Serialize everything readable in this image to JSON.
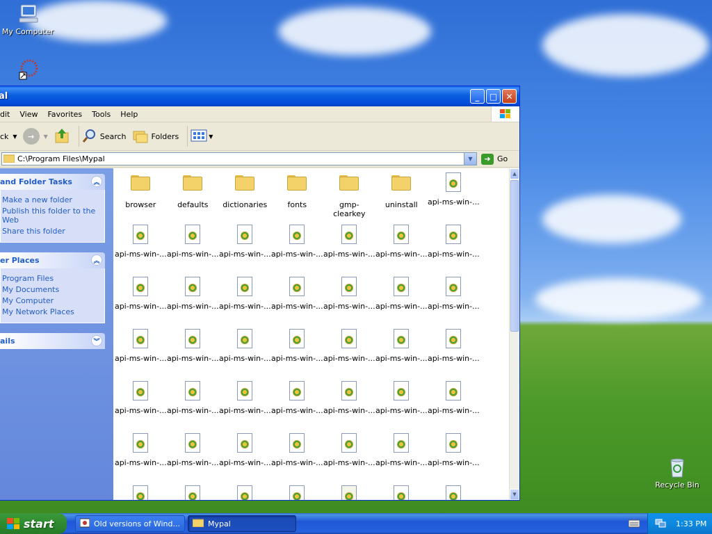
{
  "desktop": {
    "icons": [
      {
        "name": "my-computer",
        "label": "My Computer"
      },
      {
        "name": "recycle-bin",
        "label": "Recycle Bin"
      }
    ]
  },
  "window": {
    "title": "al",
    "menu": [
      "dit",
      "View",
      "Favorites",
      "Tools",
      "Help"
    ],
    "toolbar": {
      "back": "ck",
      "search": "Search",
      "folders": "Folders"
    },
    "address": {
      "path": "C:\\Program Files\\Mypal",
      "go": "Go"
    },
    "tasks": {
      "file_folder": {
        "title": "and Folder Tasks",
        "items": [
          "Make a new folder",
          "Publish this folder to the Web",
          "Share this folder"
        ]
      },
      "other_places": {
        "title": "er Places",
        "items": [
          "Program Files",
          "My Documents",
          "My Computer",
          "My Network Places"
        ]
      },
      "details": {
        "title": "ails"
      }
    },
    "items": [
      {
        "type": "folder",
        "label": "browser"
      },
      {
        "type": "folder",
        "label": "defaults"
      },
      {
        "type": "folder",
        "label": "dictionaries"
      },
      {
        "type": "folder",
        "label": "fonts"
      },
      {
        "type": "folder",
        "label": "gmp-clearkey"
      },
      {
        "type": "folder",
        "label": "uninstall"
      },
      {
        "type": "dll",
        "label": "api-ms-win-..."
      },
      {
        "type": "dll",
        "label": "api-ms-win-..."
      },
      {
        "type": "dll",
        "label": "api-ms-win-..."
      },
      {
        "type": "dll",
        "label": "api-ms-win-..."
      },
      {
        "type": "dll",
        "label": "api-ms-win-..."
      },
      {
        "type": "dll",
        "label": "api-ms-win-..."
      },
      {
        "type": "dll",
        "label": "api-ms-win-..."
      },
      {
        "type": "dll",
        "label": "api-ms-win-..."
      },
      {
        "type": "dll",
        "label": "api-ms-win-..."
      },
      {
        "type": "dll",
        "label": "api-ms-win-..."
      },
      {
        "type": "dll",
        "label": "api-ms-win-..."
      },
      {
        "type": "dll",
        "label": "api-ms-win-..."
      },
      {
        "type": "dll",
        "label": "api-ms-win-..."
      },
      {
        "type": "dll",
        "label": "api-ms-win-..."
      },
      {
        "type": "dll",
        "label": "api-ms-win-..."
      },
      {
        "type": "dll",
        "label": "api-ms-win-..."
      },
      {
        "type": "dll",
        "label": "api-ms-win-..."
      },
      {
        "type": "dll",
        "label": "api-ms-win-..."
      },
      {
        "type": "dll",
        "label": "api-ms-win-..."
      },
      {
        "type": "dll",
        "label": "api-ms-win-..."
      },
      {
        "type": "dll",
        "label": "api-ms-win-..."
      },
      {
        "type": "dll",
        "label": "api-ms-win-..."
      },
      {
        "type": "dll",
        "label": "api-ms-win-..."
      },
      {
        "type": "dll",
        "label": "api-ms-win-..."
      },
      {
        "type": "dll",
        "label": "api-ms-win-..."
      },
      {
        "type": "dll",
        "label": "api-ms-win-..."
      },
      {
        "type": "dll",
        "label": "api-ms-win-..."
      },
      {
        "type": "dll",
        "label": "api-ms-win-..."
      },
      {
        "type": "dll",
        "label": "api-ms-win-..."
      },
      {
        "type": "dll",
        "label": "api-ms-win-..."
      },
      {
        "type": "dll",
        "label": "api-ms-win-..."
      },
      {
        "type": "dll",
        "label": "api-ms-win-..."
      },
      {
        "type": "dll",
        "label": "api-ms-win-..."
      },
      {
        "type": "dll",
        "label": "api-ms-win-..."
      },
      {
        "type": "dll",
        "label": "api-ms-win-..."
      },
      {
        "type": "dll",
        "label": "api-ms-win-..."
      },
      {
        "type": "dll",
        "label": ""
      },
      {
        "type": "dll",
        "label": ""
      },
      {
        "type": "dll",
        "label": ""
      },
      {
        "type": "dll",
        "label": ""
      },
      {
        "type": "config",
        "label": ""
      },
      {
        "type": "dll",
        "label": ""
      },
      {
        "type": "dll",
        "label": ""
      }
    ]
  },
  "taskbar": {
    "start": "start",
    "tasks": [
      {
        "label": "Old versions of Wind..."
      },
      {
        "label": "Mypal"
      }
    ],
    "clock": "1:33 PM"
  },
  "colors": {
    "xp_blue": "#0a5fe8",
    "taskbar": "#2157d7",
    "start_green": "#2f8a2f",
    "link_blue": "#215dc6"
  }
}
